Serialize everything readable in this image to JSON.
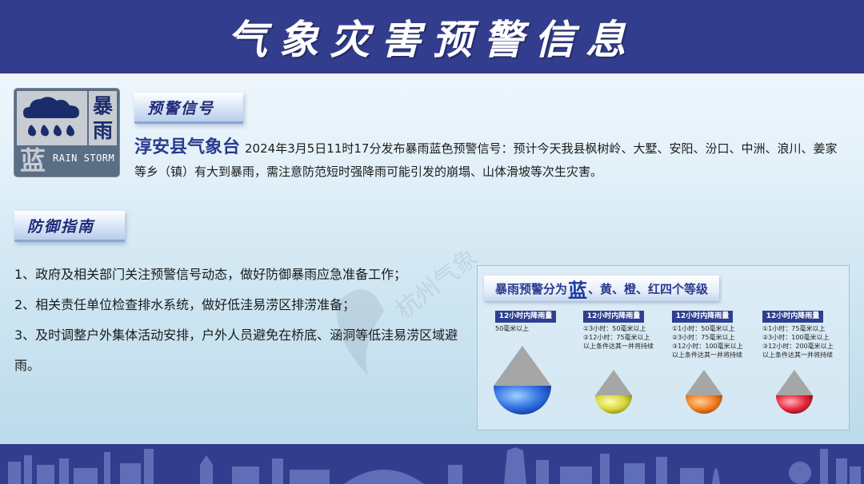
{
  "header": {
    "title": "气象灾害预警信息"
  },
  "signal_icon": {
    "chars": [
      "暴",
      "雨"
    ],
    "level_char": "蓝",
    "english": "RAIN STORM"
  },
  "section1": {
    "tag": "预警信号"
  },
  "notice": {
    "org": "淳安县气象台",
    "text": "2024年3月5日11时17分发布暴雨蓝色预警信号：预计今天我县枫树岭、大墅、安阳、汾口、中洲、浪川、姜家等乡（镇）有大到暴雨，需注意防范短时强降雨可能引发的崩塌、山体滑坡等次生灾害。"
  },
  "section2": {
    "tag": "防御指南"
  },
  "guide": {
    "items": [
      "1、政府及相关部门关注预警信号动态，做好防御暴雨应急准备工作；",
      "2、相关责任单位检查排水系统，做好低洼易涝区排涝准备；",
      "3、及时调整户外集体活动安排，户外人员避免在桥底、涵洞等低洼易涝区域避雨。"
    ]
  },
  "levels_panel": {
    "title_prefix": "暴雨预警分为",
    "title_highlight": "蓝",
    "title_suffix": "、黄、橙、红四个等级",
    "levels": [
      {
        "head": "12小时内降雨量",
        "desc": "50毫米以上",
        "color": "#2f6fe0"
      },
      {
        "head": "12小时内降雨量",
        "desc": "①3小时：50毫米以上\n②12小时：75毫米以上\n以上条件达其一并将持续",
        "color": "#d6d63a"
      },
      {
        "head": "12小时内降雨量",
        "desc": "①1小时：50毫米以上\n②3小时：75毫米以上\n③12小时：100毫米以上\n以上条件达其一并将持续",
        "color": "#f07c1e"
      },
      {
        "head": "12小时内降雨量",
        "desc": "①1小时：75毫米以上\n②3小时：100毫米以上\n③12小时：200毫米以上\n以上条件达其一并将持续",
        "color": "#e3283a"
      }
    ],
    "watermark": "杭州气象"
  }
}
